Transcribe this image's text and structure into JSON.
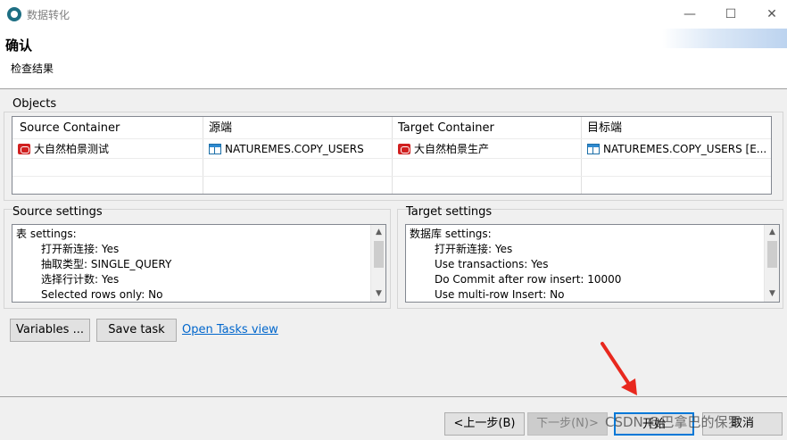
{
  "window": {
    "title": "数据转化"
  },
  "header": {
    "title": "确认",
    "subtitle": "检查结果"
  },
  "objects": {
    "label": "Objects",
    "columns": [
      "Source Container",
      "源端",
      "Target Container",
      "目标端"
    ],
    "rows": [
      {
        "source_container": "大自然柏景测试",
        "source": "NATUREMES.COPY_USERS",
        "target_container": "大自然柏景生产",
        "target": "NATUREMES.COPY_USERS [E..."
      }
    ]
  },
  "source_settings": {
    "label": "Source settings",
    "lines": [
      "表 settings:",
      "打开新连接: Yes",
      "抽取类型: SINGLE_QUERY",
      "选择行计数: Yes",
      "Selected rows only: No"
    ]
  },
  "target_settings": {
    "label": "Target settings",
    "lines": [
      "数据库 settings:",
      "打开新连接: Yes",
      "Use transactions: Yes",
      "Do Commit after row insert: 10000",
      "Use multi-row Insert: No"
    ]
  },
  "actions": {
    "variables": "Variables ...",
    "save_task": "Save task",
    "open_tasks_view": "Open Tasks view"
  },
  "footer": {
    "back": "<上一步(B)",
    "next": "下一步(N)>",
    "start": "开始",
    "cancel": "取消"
  },
  "watermark": "CSDN @巴拿巴的保罗",
  "colors": {
    "accent": "#0078d7",
    "link": "#0066cc",
    "db_icon": "#d02020",
    "arrow": "#e8281e"
  }
}
